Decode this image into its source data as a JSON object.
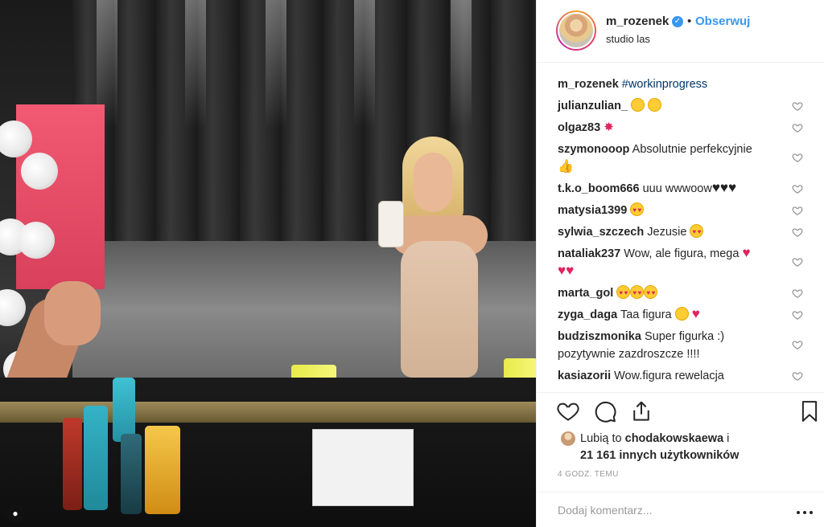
{
  "post": {
    "username": "m_rozenek",
    "verified_glyph": "✓",
    "separator": "•",
    "follow_label": "Obserwuj",
    "location": "studio las",
    "caption_user": "m_rozenek",
    "caption_text": "#workinprogress"
  },
  "comments": [
    {
      "user": "julianzulian_",
      "text": ""
    },
    {
      "user": "olgaz83",
      "text": ""
    },
    {
      "user": "szymonooop",
      "text": "Absolutnie perfekcyjnie"
    },
    {
      "user": "t.k.o_boom666",
      "text": "uuu wwwoow"
    },
    {
      "user": "matysia1399",
      "text": ""
    },
    {
      "user": "sylwia_szczech",
      "text": "Jezusie"
    },
    {
      "user": "nataliak237",
      "text": "Wow, ale figura, mega"
    },
    {
      "user": "marta_gol",
      "text": ""
    },
    {
      "user": "zyga_daga",
      "text": "Taa figura"
    },
    {
      "user": "budziszmonika",
      "text": "Super figurka :) pozytywnie zazdroszcze !!!!"
    },
    {
      "user": "kasiazorii",
      "text": "Wow.figura rewelacja"
    }
  ],
  "likes": {
    "prefix": "Lubią to",
    "user": "chodakowskaewa",
    "mid": "i",
    "count_text": "21 161 innych użytkowników"
  },
  "time": "4 GODZ. TEMU",
  "add_comment": {
    "placeholder": "Dodaj komentarz..."
  },
  "icons": {
    "like": "heart-outline-icon",
    "comment": "speech-bubble-icon",
    "share": "share-arrow-icon",
    "save": "bookmark-icon",
    "more": "ellipsis-icon"
  },
  "colors": {
    "link": "#3897f0",
    "text": "#262626",
    "muted": "#999999",
    "border": "#efefef"
  }
}
